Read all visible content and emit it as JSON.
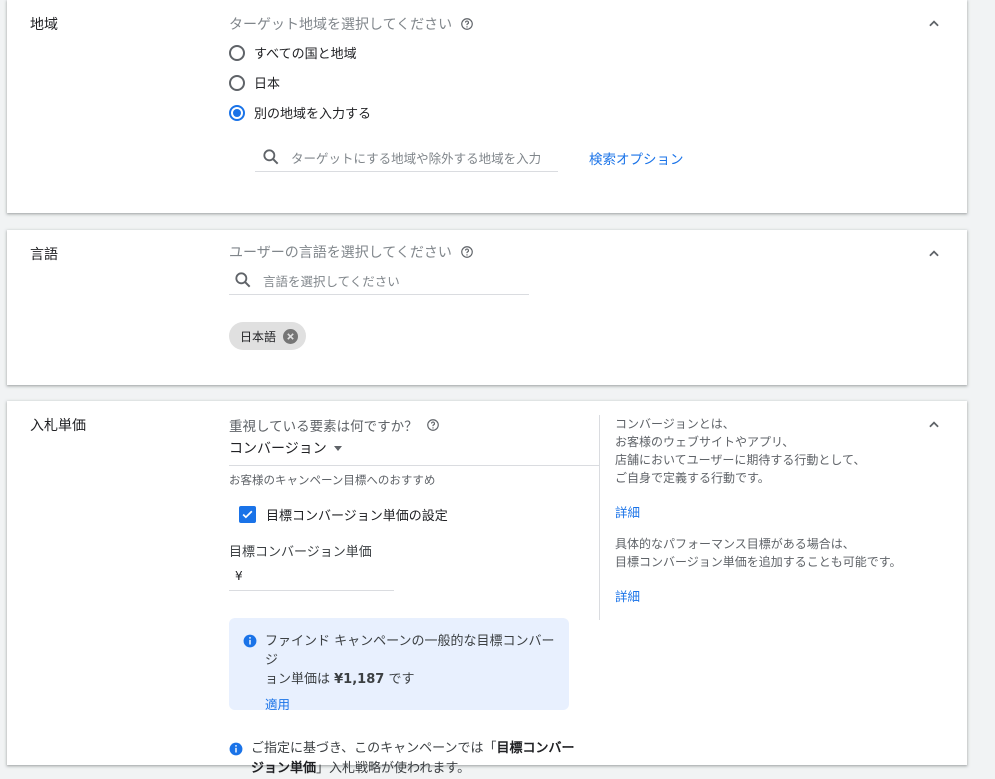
{
  "region": {
    "title": "地域",
    "hint": "ターゲット地域を選択してください",
    "options": [
      {
        "label": "すべての国と地域",
        "selected": false
      },
      {
        "label": "日本",
        "selected": false
      },
      {
        "label": "別の地域を入力する",
        "selected": true
      }
    ],
    "search_placeholder": "ターゲットにする地域や除外する地域を入力",
    "search_options_link": "検索オプション"
  },
  "language": {
    "title": "言語",
    "hint": "ユーザーの言語を選択してください",
    "search_placeholder": "言語を選択してください",
    "chip": "日本語"
  },
  "bidding": {
    "title": "入札単価",
    "question": "重視している要素は何ですか？",
    "focus_value": "コンバージョン",
    "recommend_label": "お客様のキャンペーン目標へのおすすめ",
    "checkbox_label": "目標コンバージョン単価の設定",
    "checkbox_checked": true,
    "cpa_label": "目標コンバージョン単価",
    "currency_symbol": "¥",
    "info_line1": "ファインド キャンペーンの一般的な目標コンバージ",
    "info_line2_pre": "ョン単価は ",
    "info_value": "¥1,187",
    "info_line2_post": " です",
    "info_apply": "適用",
    "side_lines1": [
      "コンバージョンとは、",
      "お客様のウェブサイトやアプリ、",
      "店舗においてユーザーに期待する行動として、",
      "ご自身で定義する行動です。"
    ],
    "side_link1": "詳細",
    "side_lines2": [
      "具体的なパフォーマンス目標がある場合は、",
      "目標コンバージョン単価を追加することも可能です。"
    ],
    "side_link2": "詳細",
    "bottom_pre": "ご指定に基づき、このキャンペーンでは「",
    "bottom_bold1": "目標コンバー",
    "bottom_bold2": "ジョン単価",
    "bottom_post": "」入札戦略が使われます。"
  },
  "colors": {
    "accent": "#1a73e8",
    "info_bg": "#e8f0fe",
    "chip_bg": "#e0e0e0"
  }
}
